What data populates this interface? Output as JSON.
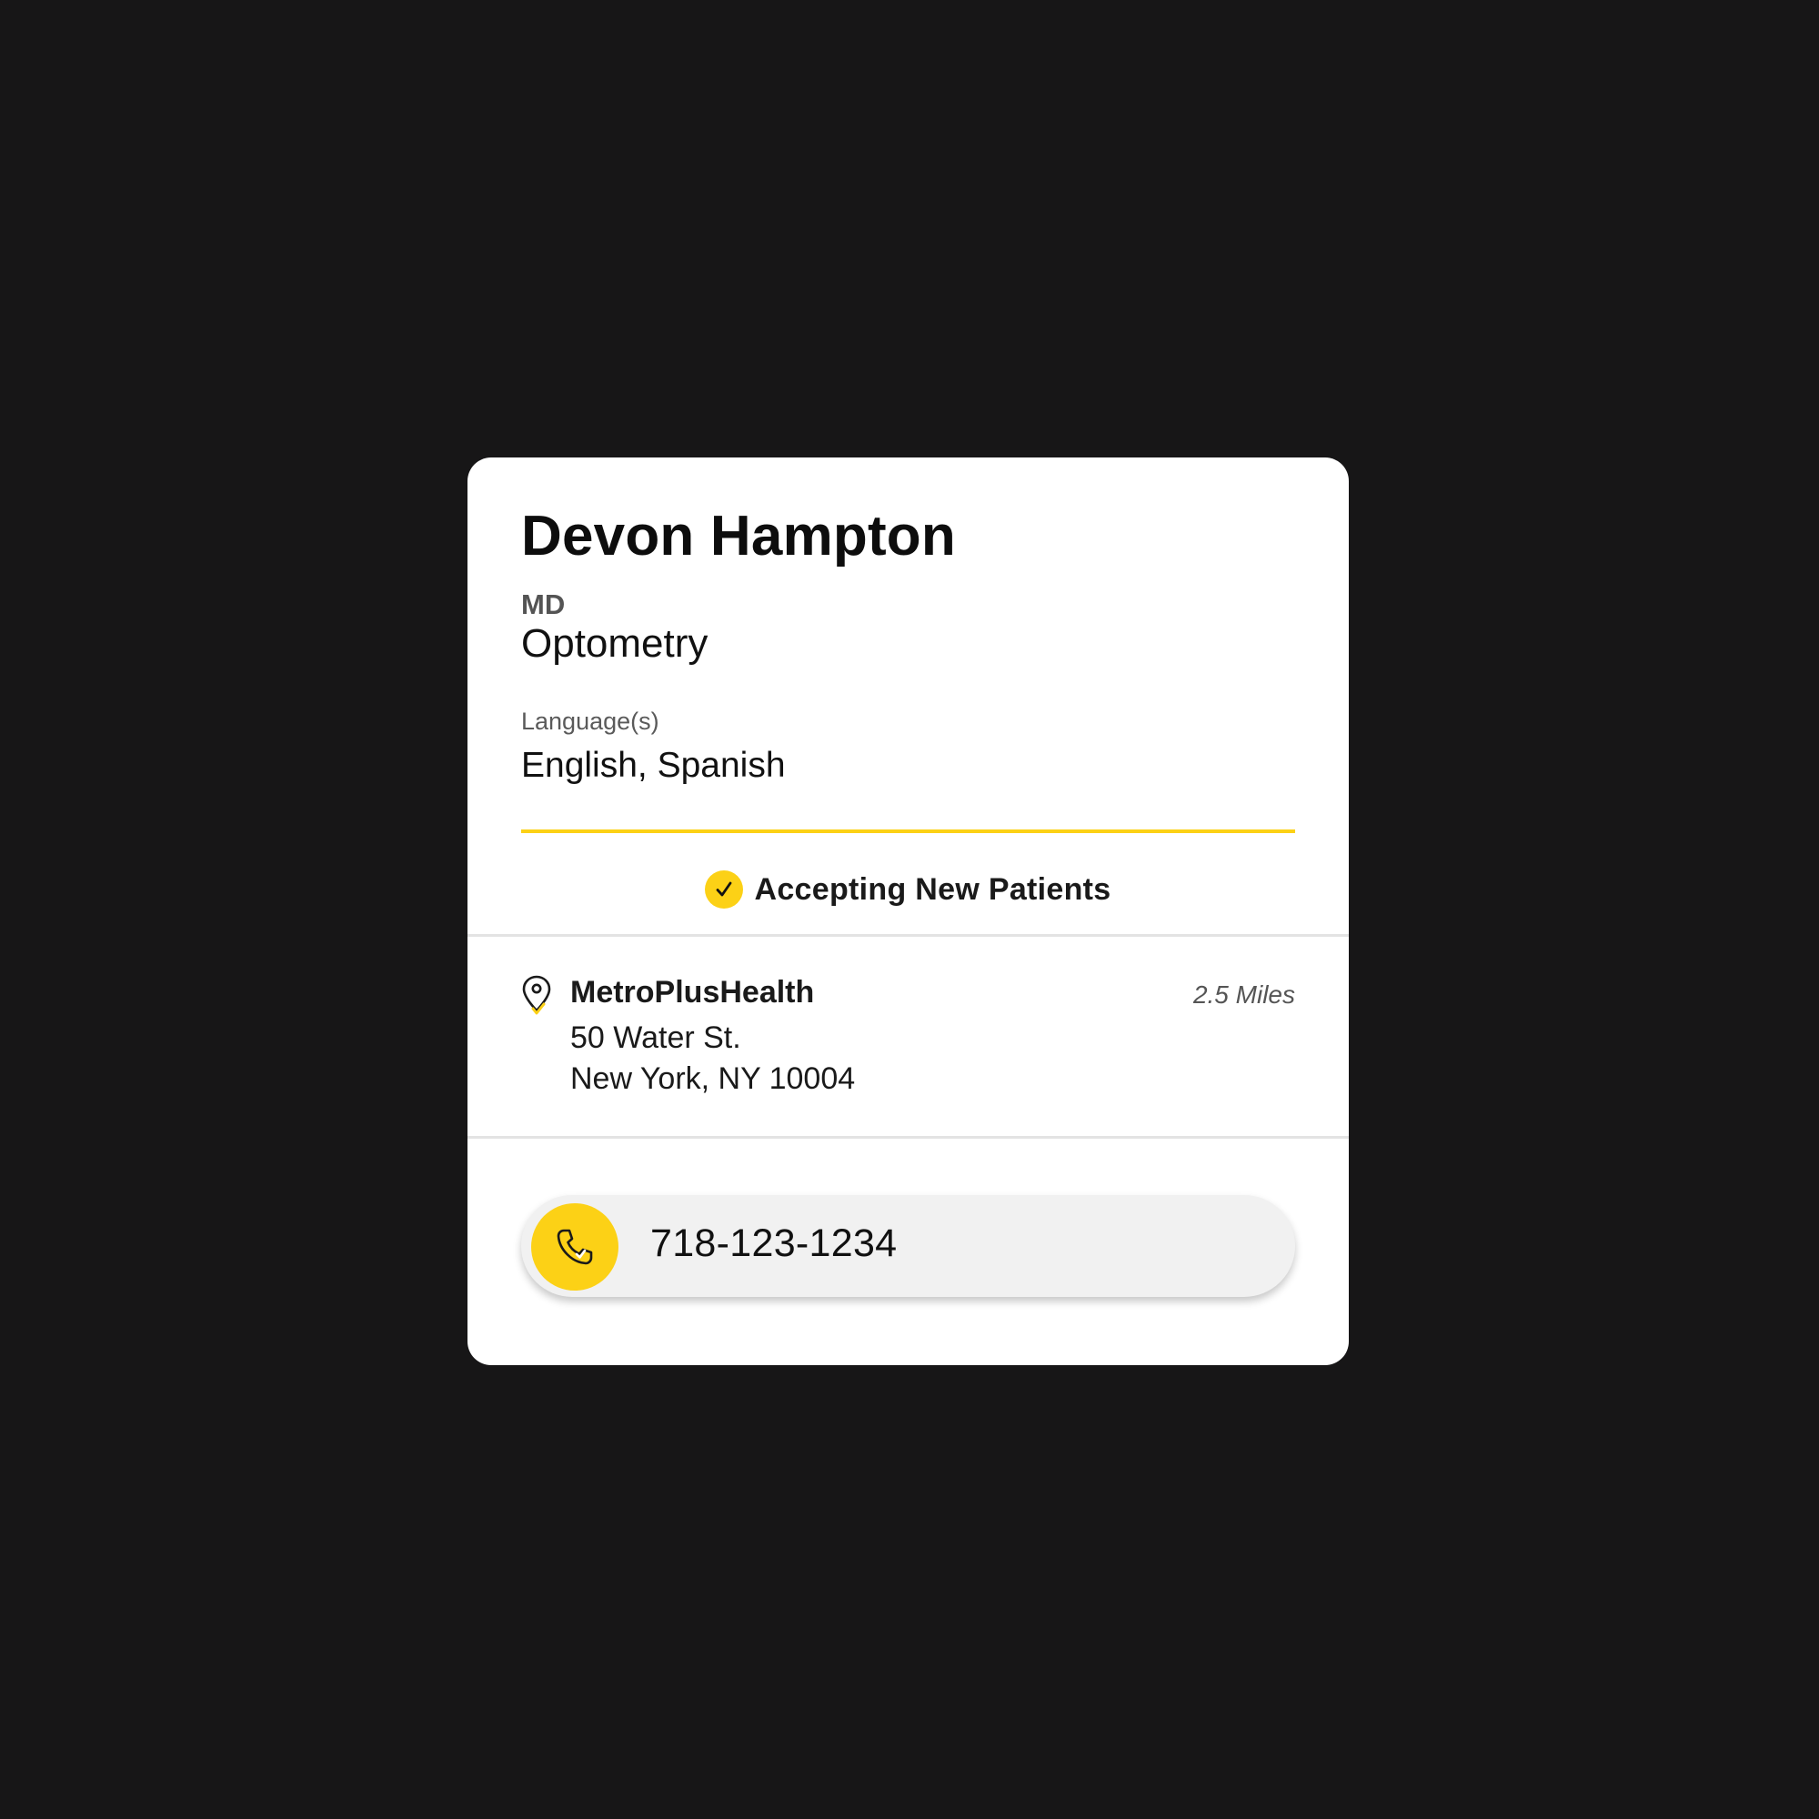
{
  "provider": {
    "name": "Devon Hampton",
    "credential": "MD",
    "specialty": "Optometry",
    "languages_label": "Language(s)",
    "languages_value": "English, Spanish"
  },
  "status": {
    "accepting_label": "Accepting New Patients",
    "icon": "check-circle-icon"
  },
  "location": {
    "name": "MetroPlusHealth",
    "address_line1": "50 Water St.",
    "address_line2": "New York, NY 10004",
    "distance": "2.5 Miles",
    "icon": "map-pin-icon"
  },
  "contact": {
    "phone": "718-123-1234",
    "icon": "phone-icon"
  },
  "theme": {
    "background": "#171617",
    "card": "#ffffff",
    "accent": "#fcd116",
    "pill": "#f1f1f1",
    "divider": "#e3e3e3"
  }
}
